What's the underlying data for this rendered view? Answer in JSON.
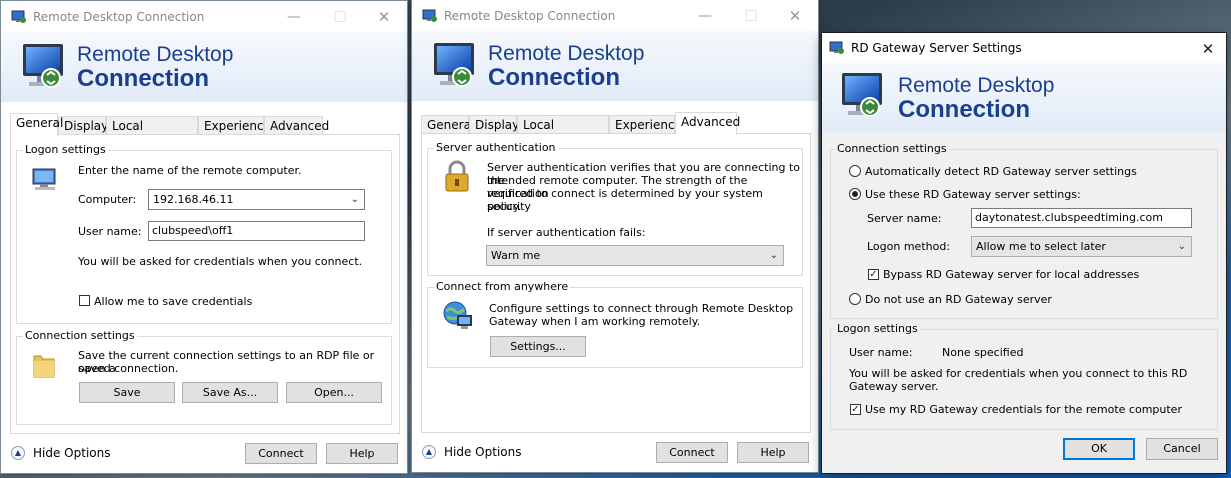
{
  "colors": {
    "accent": "#0078d7",
    "banner_text": "#1b3f8f"
  },
  "icons": {
    "app": "remote-desktop-icon",
    "monitor": "monitor-icon",
    "lock": "padlock-icon",
    "folder": "folder-icon",
    "globe": "globe-icon"
  },
  "win1": {
    "title": "Remote Desktop Connection",
    "banner_line1": "Remote Desktop",
    "banner_line2": "Connection",
    "tabs": [
      "General",
      "Display",
      "Local Resources",
      "Experience",
      "Advanced"
    ],
    "selected_tab": "General",
    "logon": {
      "group_label": "Logon settings",
      "intro": "Enter the name of the remote computer.",
      "computer_label": "Computer:",
      "computer_value": "192.168.46.11",
      "user_label": "User name:",
      "user_value": "clubspeed\\off1",
      "note": "You will be asked for credentials when you connect.",
      "save_creds_label": "Allow me to save credentials"
    },
    "conn": {
      "group_label": "Connection settings",
      "desc_line1": "Save the current connection settings to an RDP file or open a",
      "desc_line2": "saved connection.",
      "save": "Save",
      "save_as": "Save As...",
      "open": "Open..."
    },
    "hide_options": "Hide Options",
    "connect": "Connect",
    "help": "Help"
  },
  "win2": {
    "title": "Remote Desktop Connection",
    "banner_line1": "Remote Desktop",
    "banner_line2": "Connection",
    "tabs": [
      "General",
      "Display",
      "Local Resources",
      "Experience",
      "Advanced"
    ],
    "selected_tab": "Advanced",
    "server_auth": {
      "group_label": "Server authentication",
      "desc_line1": "Server authentication verifies that you are connecting to the",
      "desc_line2": "intended remote computer. The strength of the verification",
      "desc_line3": "required to connect is determined by your system security",
      "desc_line4": "policy.",
      "fail_label": "If server authentication fails:",
      "fail_value": "Warn me"
    },
    "anywhere": {
      "group_label": "Connect from anywhere",
      "desc_line1": "Configure settings to connect through Remote Desktop",
      "desc_line2": "Gateway when I am working remotely.",
      "settings": "Settings..."
    },
    "hide_options": "Hide Options",
    "connect": "Connect",
    "help": "Help"
  },
  "win3": {
    "title": "RD Gateway Server Settings",
    "banner_line1": "Remote Desktop",
    "banner_line2": "Connection",
    "conn": {
      "group_label": "Connection settings",
      "auto_detect": "Automatically detect RD Gateway server settings",
      "use_these": "Use these RD Gateway server settings:",
      "server_label": "Server name:",
      "server_value": "daytonatest.clubspeedtiming.com",
      "logon_label": "Logon method:",
      "logon_value": "Allow me to select later",
      "bypass": "Bypass RD Gateway server for local addresses",
      "do_not_use": "Do not use an RD Gateway server"
    },
    "logon": {
      "group_label": "Logon settings",
      "user_label": "User name:",
      "user_value": "None specified",
      "note_line1": "You will be asked for credentials when you connect to this RD",
      "note_line2": "Gateway server.",
      "use_creds": "Use my RD Gateway credentials for the remote computer"
    },
    "ok": "OK",
    "cancel": "Cancel"
  }
}
